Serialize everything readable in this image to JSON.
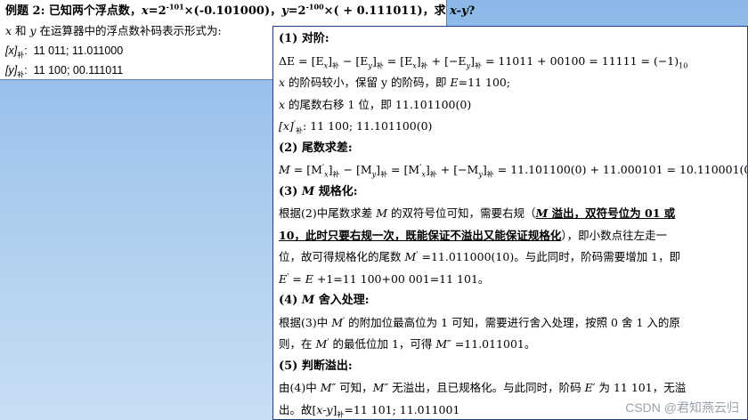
{
  "problem": {
    "title": "例题 2: 已知两个浮点数，x=2-101×(-0.101000)，y=2-100×( + 0.111011)，求 x-y?",
    "title_parts": {
      "prefix": "例题 2:  已知两个浮点数，",
      "x_var": "x",
      "x_eq": "=2",
      "x_exp": "-101",
      "x_mant": "×(-0.101000)，",
      "y_var": "y",
      "y_eq": "=2",
      "y_exp": "-100",
      "y_mant": "×( + 0.111011)，求 ",
      "ask": "x-y",
      "q": "?"
    },
    "desc_x": "x",
    "desc_and": " 和 ",
    "desc_y": "y",
    "desc_rest": " 在运算器中的浮点数补码表示形式为:",
    "x_code_label": "[x]",
    "x_code_sub": "补",
    "x_code_colon": ":",
    "x_code_value": "11 011; 11.011000",
    "y_code_label": "[y]",
    "y_code_sub": "补",
    "y_code_colon": ":",
    "y_code_value": "11 100; 00.111011"
  },
  "solution": {
    "s1_head": "(1)  对阶:",
    "s1_eq_a": "ΔE = [E",
    "s1_eq_b": "x",
    "s1_eq_c": "]",
    "s1_eq_d": "补",
    "s1_eq_e": " − [E",
    "s1_eq_f": "y",
    "s1_eq_g": "]",
    "s1_eq_h": "补",
    "s1_eq_i": " = [E",
    "s1_eq_j": "x",
    "s1_eq_k": "]",
    "s1_eq_l": "补",
    "s1_eq_m": " + [−E",
    "s1_eq_n": "y",
    "s1_eq_o": "]",
    "s1_eq_p": "补",
    "s1_eq_q": " = 11011 + 00100 = 11111 = (−1)",
    "s1_eq_r": "10",
    "s1_l2_x": "x",
    "s1_l2_text": " 的阶码较小，保留 y 的阶码，即 ",
    "s1_l2_E": "E",
    "s1_l2_val": "=11 100;",
    "s1_l3_x": "x",
    "s1_l3_text": " 的尾数右移 1 位，即 11.101100(0)",
    "s1_l4_label": "[x]",
    "s1_l4_sup": "'",
    "s1_l4_sub": "补",
    "s1_l4_val": ":  11 100; 11.101100(0)",
    "s2_head": "(2)  尾数求差:",
    "s2_eq_a": "M",
    "s2_eq_b": " = [M",
    "s2_eq_c": "'",
    "s2_eq_d": "x",
    "s2_eq_e": "]",
    "s2_eq_f": "补",
    "s2_eq_g": " − [M",
    "s2_eq_h": "y",
    "s2_eq_i": "]",
    "s2_eq_j": "补",
    "s2_eq_k": " = [M",
    "s2_eq_l": "'",
    "s2_eq_m": "x",
    "s2_eq_n": "]",
    "s2_eq_o": "补",
    "s2_eq_p": " + [−M",
    "s2_eq_q": "y",
    "s2_eq_r": "]",
    "s2_eq_s": "补",
    "s2_eq_t": " = 11.101100(0) + 11.000101 = 10.110001(0)",
    "s3_head_a": "(3) ",
    "s3_head_M": "M",
    "s3_head_b": " 规格化:",
    "s3_l1_a": "根据(2)中尾数求差 ",
    "s3_l1_M": "M",
    "s3_l1_b": " 的双符号位可知，需要右规（",
    "s3_l1_c_M": "M",
    "s3_l1_c": " 溢出，双符号位为 01 或",
    "s3_l2_a": "10，此时只要右规一次，既能保证不溢出又能保证规格化",
    "s3_l2_b": "），即小数点往左走一",
    "s3_l3_a": "位，故可得规格化的尾数 ",
    "s3_l3_M": "M",
    "s3_l3_sup": "'",
    "s3_l3_b": " =11.011000(10)。与此同时，阶码需要增加 1，即",
    "s3_l4_E": "E",
    "s3_l4_sup": "'",
    "s3_l4_b": " = ",
    "s3_l4_E2": "E",
    "s3_l4_c": " +1=11 100+00 001=11 101。",
    "s4_head_a": "(4) ",
    "s4_head_M": "M",
    "s4_head_b": " 舍入处理:",
    "s4_l1_a": "根据(3)中 ",
    "s4_l1_M": "M",
    "s4_l1_sup": "'",
    "s4_l1_b": " 的附加位最高位为 1 可知，需要进行舍入处理，按照 0 舍 1 入的原",
    "s4_l2_a": "则，在 ",
    "s4_l2_M": "M",
    "s4_l2_sup": "'",
    "s4_l2_b": " 的最低位加 1，可得 ",
    "s4_l2_M2": "M″",
    "s4_l2_c": " =11.011001。",
    "s5_head": "(5)  判断溢出:",
    "s5_l1_a": "由(4)中 ",
    "s5_l1_M": "M″",
    "s5_l1_b": " 可知，",
    "s5_l1_M2": "M″",
    "s5_l1_c": " 无溢出，且已规格化。与此同时，阶码 ",
    "s5_l1_E": "E′",
    "s5_l1_d": " 为 11 101，无溢",
    "s5_l2_a": "出。故[",
    "s5_l2_xy": "x-y",
    "s5_l2_b": "]",
    "s5_l2_sub": "补",
    "s5_l2_c": "=11 101; 11.011001"
  },
  "watermark": "CSDN @君知燕云归"
}
